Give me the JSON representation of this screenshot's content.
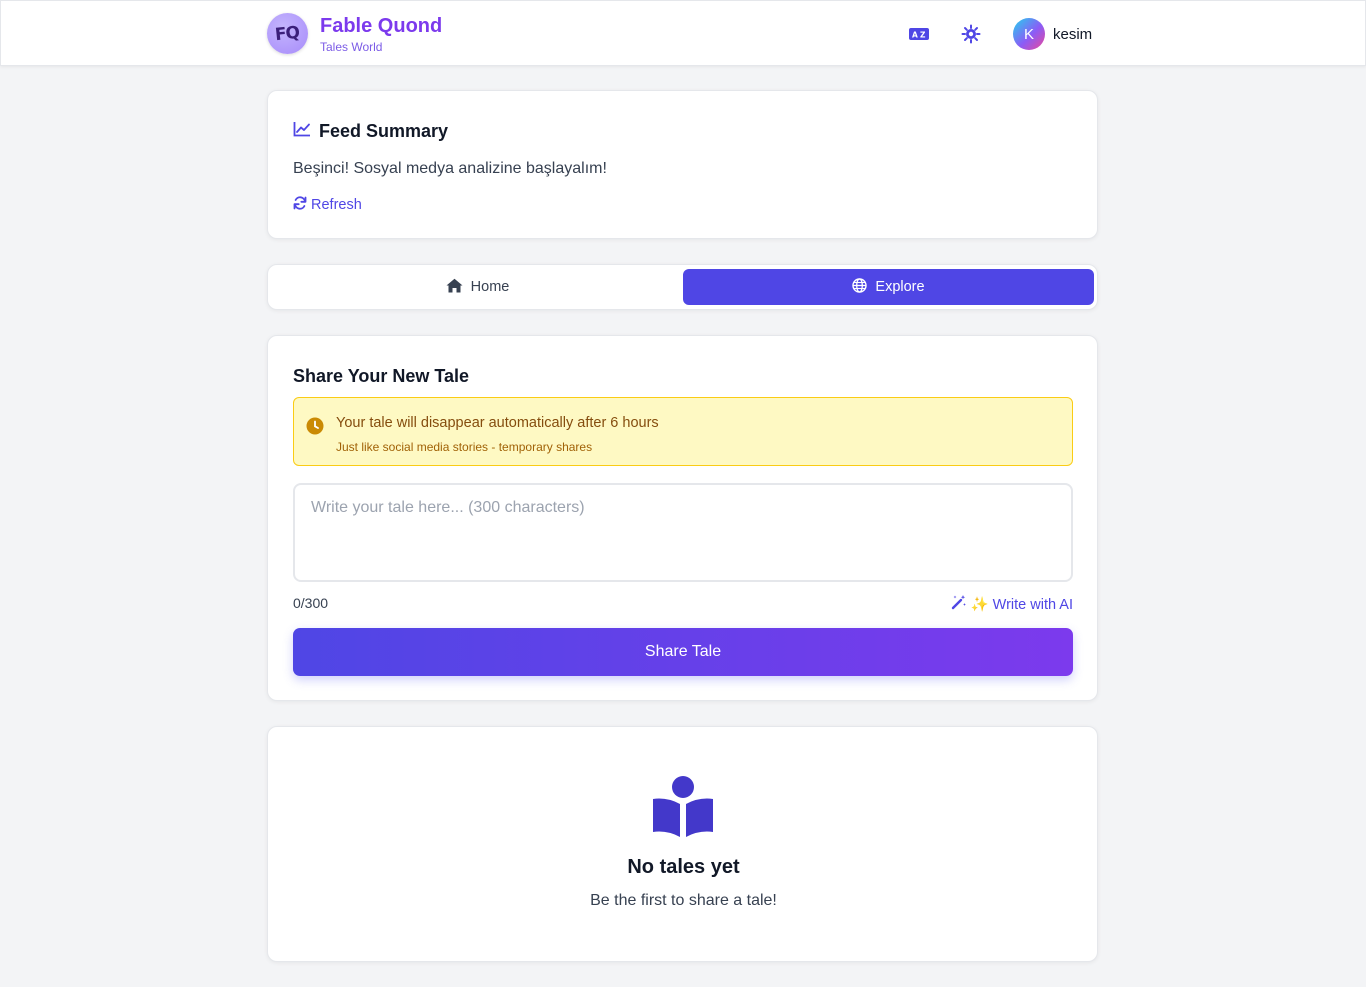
{
  "header": {
    "logo_text": "FQ",
    "title": "Fable Quond",
    "subtitle": "Tales World",
    "user": {
      "initial": "K",
      "name": "kesim"
    }
  },
  "summary": {
    "title": "Feed Summary",
    "text": "Beşinci! Sosyal medya analizine başlayalım!",
    "refresh_label": "Refresh"
  },
  "tabs": [
    {
      "label": "Home",
      "active": false
    },
    {
      "label": "Explore",
      "active": true
    }
  ],
  "compose": {
    "title": "Share Your New Tale",
    "notice_title": "Your tale will disappear automatically after 6 hours",
    "notice_sub": "Just like social media stories - temporary shares",
    "placeholder": "Write your tale here... (300 characters)",
    "value": "",
    "counter": "0/300",
    "ai_label": "✨ Write with AI",
    "share_label": "Share Tale"
  },
  "empty_state": {
    "title": "No tales yet",
    "subtitle": "Be the first to share a tale!"
  },
  "colors": {
    "primary": "#4f46e5",
    "accent": "#7c3aed",
    "notice_bg": "#fef9c3",
    "notice_border": "#facc15"
  }
}
